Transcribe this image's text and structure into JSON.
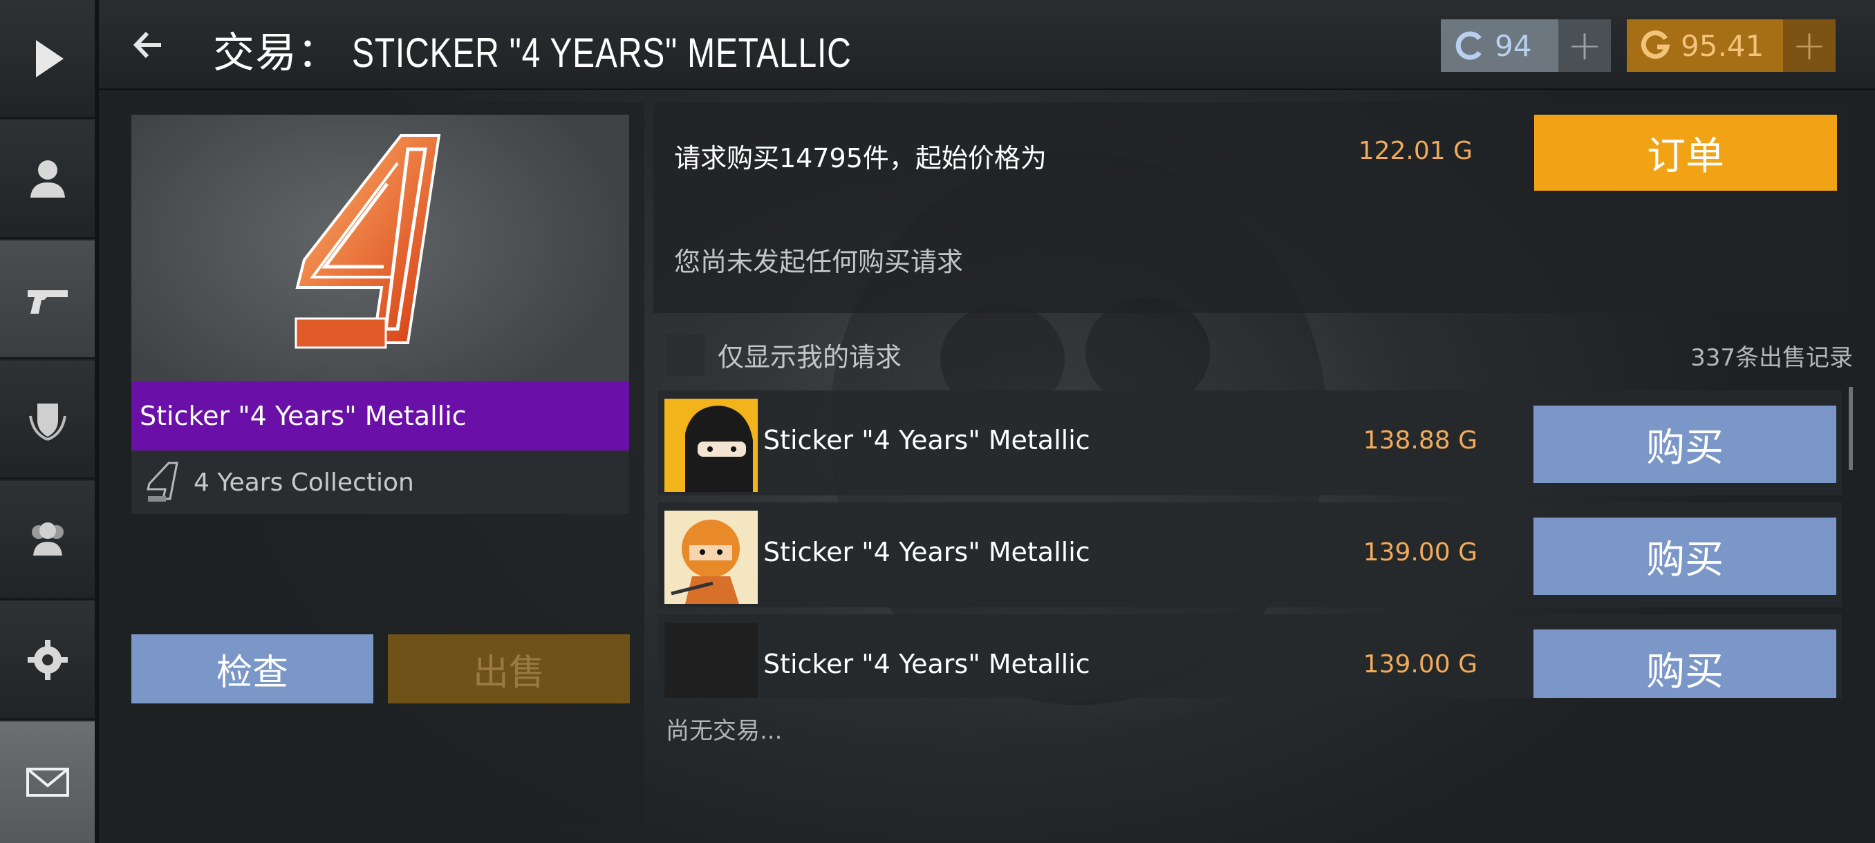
{
  "header": {
    "title_prefix": "交易：",
    "title_item": "STICKER \"4 YEARS\" METALLIC",
    "credits": {
      "value": "94",
      "plus": "+",
      "color": "#6c7780"
    },
    "gold": {
      "value": "95.41",
      "plus": "+",
      "color": "#a66e15"
    }
  },
  "sidebar": {
    "items": [
      {
        "icon": "play-icon"
      },
      {
        "icon": "profile-icon"
      },
      {
        "icon": "pistol-icon",
        "active": true
      },
      {
        "icon": "clan-shield-icon"
      },
      {
        "icon": "friends-icon"
      },
      {
        "icon": "gear-icon"
      },
      {
        "icon": "mail-icon"
      }
    ]
  },
  "item": {
    "name": "Sticker \"4 Years\" Metallic",
    "collection": "4 Years Collection",
    "rarity_color": "#6a0fa8",
    "inspect_label": "检查",
    "sell_label": "出售"
  },
  "order": {
    "request_text": "请求购买14795件，起始价格为",
    "price": "122.01 G",
    "button_label": "订单",
    "no_request_text": "您尚未发起任何购买请求"
  },
  "filter": {
    "label": "仅显示我的请求",
    "sale_count": "337条出售记录"
  },
  "listings": [
    {
      "name": "Sticker \"4 Years\" Metallic",
      "price": "138.88 G",
      "buy_label": "购买"
    },
    {
      "name": "Sticker \"4 Years\" Metallic",
      "price": "139.00 G",
      "buy_label": "购买"
    },
    {
      "name": "Sticker \"4 Years\" Metallic",
      "price": "139.00 G",
      "buy_label": "购买"
    }
  ],
  "no_trades": "尚无交易..."
}
